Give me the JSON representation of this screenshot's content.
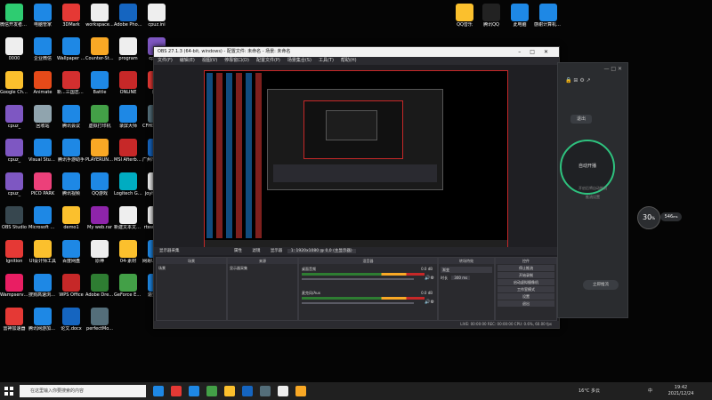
{
  "desktop_left": [
    {
      "label": "微信开发者工具",
      "color": "#2ecc71"
    },
    {
      "label": "电脑管家",
      "color": "#1e88e5"
    },
    {
      "label": "3DMark",
      "color": "#e53935"
    },
    {
      "label": "workspace...",
      "color": "#eeeeee"
    },
    {
      "label": "Adobe Photosho...",
      "color": "#1565c0"
    },
    {
      "label": "cpuz.ini",
      "color": "#eeeeee"
    },
    {
      "label": "0000",
      "color": "#eeeeee"
    },
    {
      "label": "企业微信",
      "color": "#1e88e5"
    },
    {
      "label": "Wallpaper Engine ...",
      "color": "#1e88e5"
    },
    {
      "label": "Counter-Strike Global Off...",
      "color": "#f9a825"
    },
    {
      "label": "program",
      "color": "#eeeeee"
    },
    {
      "label": "cpuz_x",
      "color": "#7e57c2"
    },
    {
      "label": "Google Chrome",
      "color": "#fbc02d"
    },
    {
      "label": "Animate",
      "color": "#e64a19"
    },
    {
      "label": "新...三国志双击",
      "color": "#d32f2f"
    },
    {
      "label": "Battle",
      "color": "#1e88e5"
    },
    {
      "label": "ONLINE",
      "color": "#c62828"
    },
    {
      "label": "腾讯",
      "color": "#e53935"
    },
    {
      "label": "cpuz_",
      "color": "#7e57c2"
    },
    {
      "label": "回收站",
      "color": "#90a4ae"
    },
    {
      "label": "腾讯会议",
      "color": "#1e88e5"
    },
    {
      "label": "虚拟打印机",
      "color": "#43a047"
    },
    {
      "label": "录屏大师",
      "color": "#1e88e5"
    },
    {
      "label": "CFHD专属竞技宝箱",
      "color": "#546e7a"
    },
    {
      "label": "cpuz_",
      "color": "#7e57c2"
    },
    {
      "label": "Visual Studio Code",
      "color": "#1e88e5"
    },
    {
      "label": "腾讯手游助手",
      "color": "#1e88e5"
    },
    {
      "label": "PLAYERUNKNOWN'S BATTLEGR...",
      "color": "#f9a825"
    },
    {
      "label": "MSI Afterburner",
      "color": "#c62828"
    },
    {
      "label": "广州市番禺区 网吧计算机管理",
      "color": "#1565c0"
    },
    {
      "label": "cpuz_",
      "color": "#7e57c2"
    },
    {
      "label": "PICO PARK",
      "color": "#ec407a"
    },
    {
      "label": "腾讯视频",
      "color": "#1e88e5"
    },
    {
      "label": "QQ游戏",
      "color": "#1e88e5"
    },
    {
      "label": "Logitech G HUB",
      "color": "#00acc1"
    },
    {
      "label": "joyhds_v...",
      "color": "#eeeeee"
    },
    {
      "label": "OBS Studio",
      "color": "#37474f"
    },
    {
      "label": "Microsoft Edge",
      "color": "#1e88e5"
    },
    {
      "label": "demo1",
      "color": "#fbc02d"
    },
    {
      "label": "My web.rar",
      "color": "#8e24aa"
    },
    {
      "label": "新建文本文档.txt",
      "color": "#eeeeee"
    },
    {
      "label": "rtssr_en_j...",
      "color": "#eeeeee"
    },
    {
      "label": "Ignition",
      "color": "#e53935"
    },
    {
      "label": "UI设计师工具",
      "color": "#fbc02d"
    },
    {
      "label": "百度网盘",
      "color": "#1e88e5"
    },
    {
      "label": "原神",
      "color": "#eeeeee"
    },
    {
      "label": "04-素材",
      "color": "#fbc02d"
    },
    {
      "label": "网易UU加速器",
      "color": "#1e88e5"
    },
    {
      "label": "Wampserver64",
      "color": "#e91e63"
    },
    {
      "label": "搜狗高速浏览器",
      "color": "#1e88e5"
    },
    {
      "label": "WPS Office",
      "color": "#c62828"
    },
    {
      "label": "Adobe Dreamwe...",
      "color": "#2e7d32"
    },
    {
      "label": "GeForce Experience",
      "color": "#43a047"
    },
    {
      "label": "造梦西游",
      "color": "#1e88e5"
    },
    {
      "label": "雷神加速器",
      "color": "#e53935"
    },
    {
      "label": "腾讯网游加速器",
      "color": "#1e88e5"
    },
    {
      "label": "论文.docx",
      "color": "#1565c0"
    },
    {
      "label": "perfectMo...",
      "color": "#546e7a"
    }
  ],
  "desktop_right": [
    {
      "label": "QQ音乐",
      "color": "#fbc02d"
    },
    {
      "label": "腾讯QQ",
      "color": "#222222"
    },
    {
      "label": "此电脑",
      "color": "#1e88e5"
    },
    {
      "label": "感谢计算机平台",
      "color": "#1e88e5"
    }
  ],
  "obs": {
    "title": "OBS 27.1.3 (64-bit, windows) - 配置文件: 未命名 - 场景: 未命名",
    "menu": [
      "文件(F)",
      "编辑(E)",
      "视图(V)",
      "停靠窗口(D)",
      "配置文件(P)",
      "场景集合(S)",
      "工具(T)",
      "帮助(H)"
    ],
    "source_bar": "显示器采集",
    "props_btn": "属性",
    "filter_btn": "滤镜",
    "display_label": "显示器",
    "display_value": "1: 1920x1080 @ 0,0 (主显示器)",
    "docks": {
      "scenes": "场景",
      "sources": "来源",
      "mixer": "混音器",
      "transitions": "转场特效",
      "controls": "控件"
    },
    "scene_item": "场景",
    "source_item": "显示器采集",
    "mixer": [
      {
        "name": "桌面音频",
        "db": "0.0 dB"
      },
      {
        "name": "麦克风/Aux",
        "db": "0.0 dB"
      }
    ],
    "transition_value": "渐变",
    "duration_label": "时长",
    "duration_value": "300 ms",
    "controls": [
      "停止推流",
      "开始录制",
      "启动虚拟摄像机",
      "工作室模式",
      "设置",
      "退出"
    ],
    "status": "LIVE: 00:00:00    REC: 00:00:00    CPU: 0.6%, 60.00 fps"
  },
  "sideapp": {
    "btn_top": "退出",
    "circle": "自动开播",
    "hint": "开启后将自动推流",
    "hint2": "推流设置",
    "badge": "30",
    "badge_unit": "%",
    "stat": "546",
    "stat_unit": "ms",
    "bottom_btn": "立即推流"
  },
  "taskbar": {
    "search_placeholder": "在这里输入你要搜索的内容",
    "weather": "16°C 多云",
    "time": "19:42",
    "date": "2021/12/24",
    "ime": "中",
    "icon_colors": [
      "#1e88e5",
      "#e53935",
      "#1e88e5",
      "#43a047",
      "#fbc02d",
      "#1565c0",
      "#546e7a",
      "#eeeeee",
      "#f9a825"
    ]
  }
}
